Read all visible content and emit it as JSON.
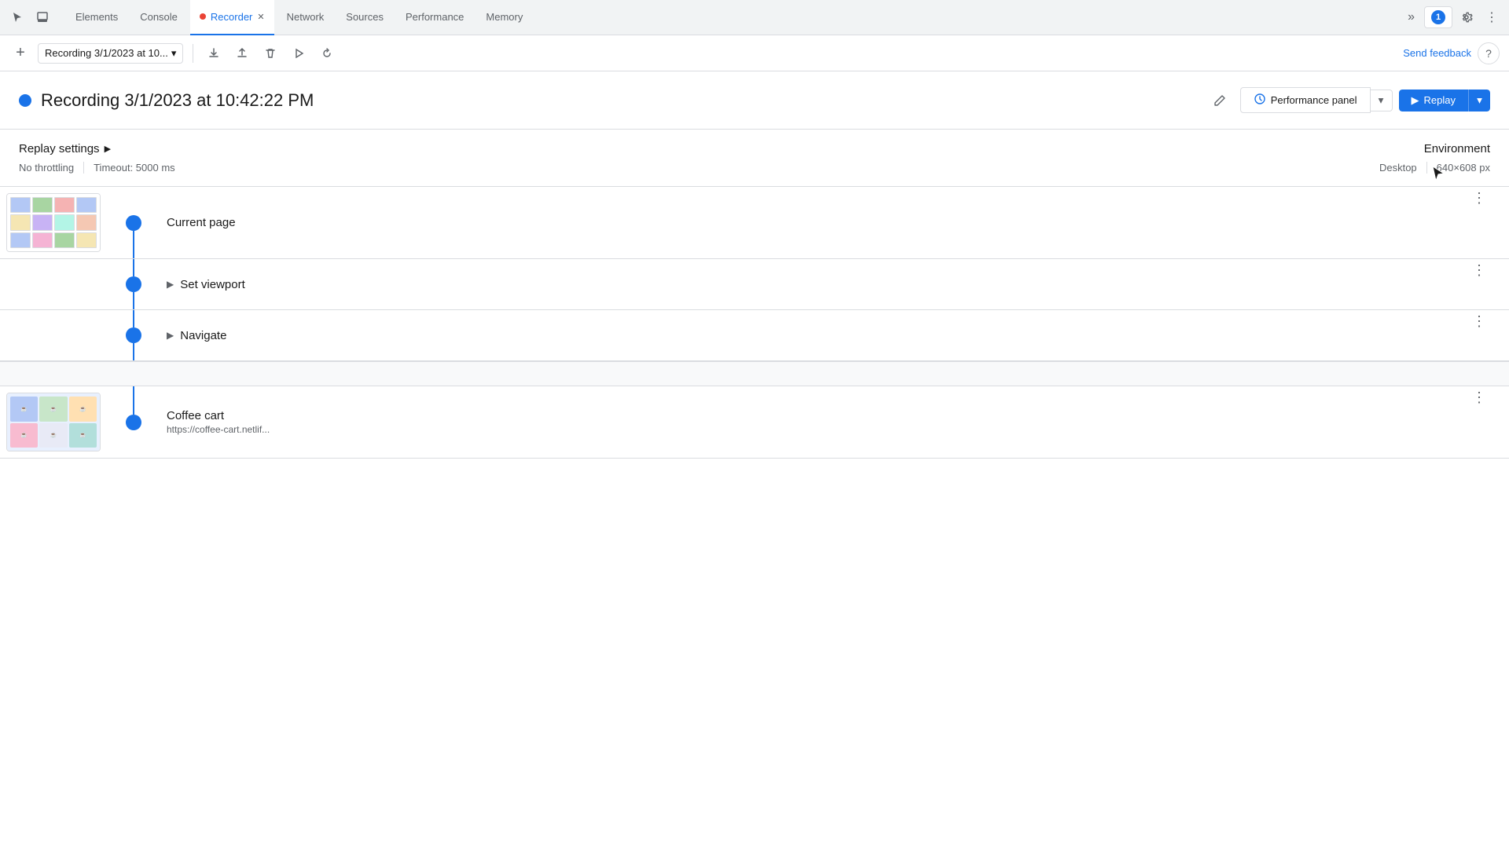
{
  "tabBar": {
    "tabs": [
      {
        "id": "elements",
        "label": "Elements",
        "active": false
      },
      {
        "id": "console",
        "label": "Console",
        "active": false
      },
      {
        "id": "recorder",
        "label": "Recorder",
        "active": true,
        "hasClose": true,
        "hasRecordingDot": true
      },
      {
        "id": "network",
        "label": "Network",
        "active": false
      },
      {
        "id": "sources",
        "label": "Sources",
        "active": false
      },
      {
        "id": "performance",
        "label": "Performance",
        "active": false
      },
      {
        "id": "memory",
        "label": "Memory",
        "active": false
      }
    ],
    "moreTabs": "»",
    "settingsBadge": "1",
    "settingsLabel": "Settings"
  },
  "toolbar": {
    "addLabel": "+",
    "recordingName": "Recording 3/1/2023 at 10...",
    "dropdownIcon": "▾",
    "uploadIcon": "↑",
    "downloadIcon": "↓",
    "deleteIcon": "🗑",
    "playIcon": "▷",
    "refreshIcon": "↺",
    "sendFeedbackLabel": "Send feedback",
    "helpLabel": "?"
  },
  "recordingHeader": {
    "title": "Recording 3/1/2023 at 10:42:22 PM",
    "editIcon": "✎",
    "perfPanelLabel": "Performance panel",
    "perfPanelIcon": "⚡",
    "dropdownIcon": "▾",
    "replayLabel": "Replay",
    "replayIcon": "▶"
  },
  "replaySettings": {
    "title": "Replay settings",
    "expandIcon": "▶",
    "throttling": "No throttling",
    "timeout": "Timeout: 5000 ms",
    "environment": {
      "title": "Environment",
      "device": "Desktop",
      "resolution": "640×608 px"
    }
  },
  "steps": [
    {
      "id": "current-page",
      "label": "Current page",
      "hasThumbnail": true,
      "isGroup": true,
      "isFirst": true,
      "moreIcon": "⋮"
    },
    {
      "id": "set-viewport",
      "label": "Set viewport",
      "hasThumbnail": false,
      "isGroup": false,
      "hasExpand": true,
      "moreIcon": "⋮"
    },
    {
      "id": "navigate",
      "label": "Navigate",
      "hasThumbnail": false,
      "isGroup": false,
      "hasExpand": true,
      "moreIcon": "⋮"
    },
    {
      "id": "coffee-cart",
      "label": "Coffee cart",
      "subtitle": "https://coffee-cart.netlif...",
      "hasThumbnail": true,
      "isGroup": true,
      "isFirst": false,
      "moreIcon": "⋮"
    }
  ],
  "cursor": {
    "icon": "↖"
  }
}
